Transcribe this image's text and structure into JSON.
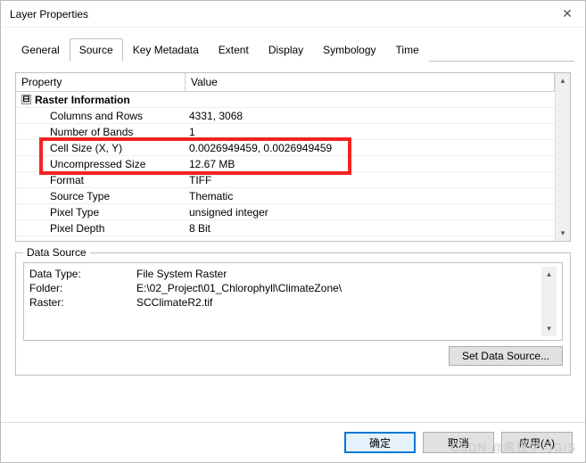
{
  "window": {
    "title": "Layer Properties"
  },
  "tabs": {
    "items": [
      {
        "label": "General"
      },
      {
        "label": "Source"
      },
      {
        "label": "Key Metadata"
      },
      {
        "label": "Extent"
      },
      {
        "label": "Display"
      },
      {
        "label": "Symbology"
      },
      {
        "label": "Time"
      }
    ],
    "active": 1
  },
  "columns": {
    "property": "Property",
    "value": "Value"
  },
  "expander": "⊟",
  "rasterInfo": {
    "group": "Raster Information",
    "rows": [
      {
        "label": "Columns and Rows",
        "value": "4331, 3068"
      },
      {
        "label": "Number of Bands",
        "value": "1"
      },
      {
        "label": "Cell Size (X, Y)",
        "value": "0.0026949459, 0.0026949459"
      },
      {
        "label": "Uncompressed Size",
        "value": "12.67 MB"
      },
      {
        "label": "Format",
        "value": "TIFF"
      },
      {
        "label": "Source Type",
        "value": "Thematic"
      },
      {
        "label": "Pixel Type",
        "value": "unsigned integer"
      },
      {
        "label": "Pixel Depth",
        "value": "8 Bit"
      }
    ]
  },
  "dataSource": {
    "legend": "Data Source",
    "rows": [
      {
        "label": "Data Type:",
        "value": "File System Raster"
      },
      {
        "label": "Folder:",
        "value": "E:\\02_Project\\01_Chlorophyll\\ClimateZone\\"
      },
      {
        "label": "Raster:",
        "value": "SCClimateR2.tif"
      }
    ],
    "button": "Set Data Source..."
  },
  "buttons": {
    "ok": "确定",
    "cancel": "取消",
    "apply": "应用(A)"
  },
  "watermark": "CSDN @疯狂学习GIS"
}
